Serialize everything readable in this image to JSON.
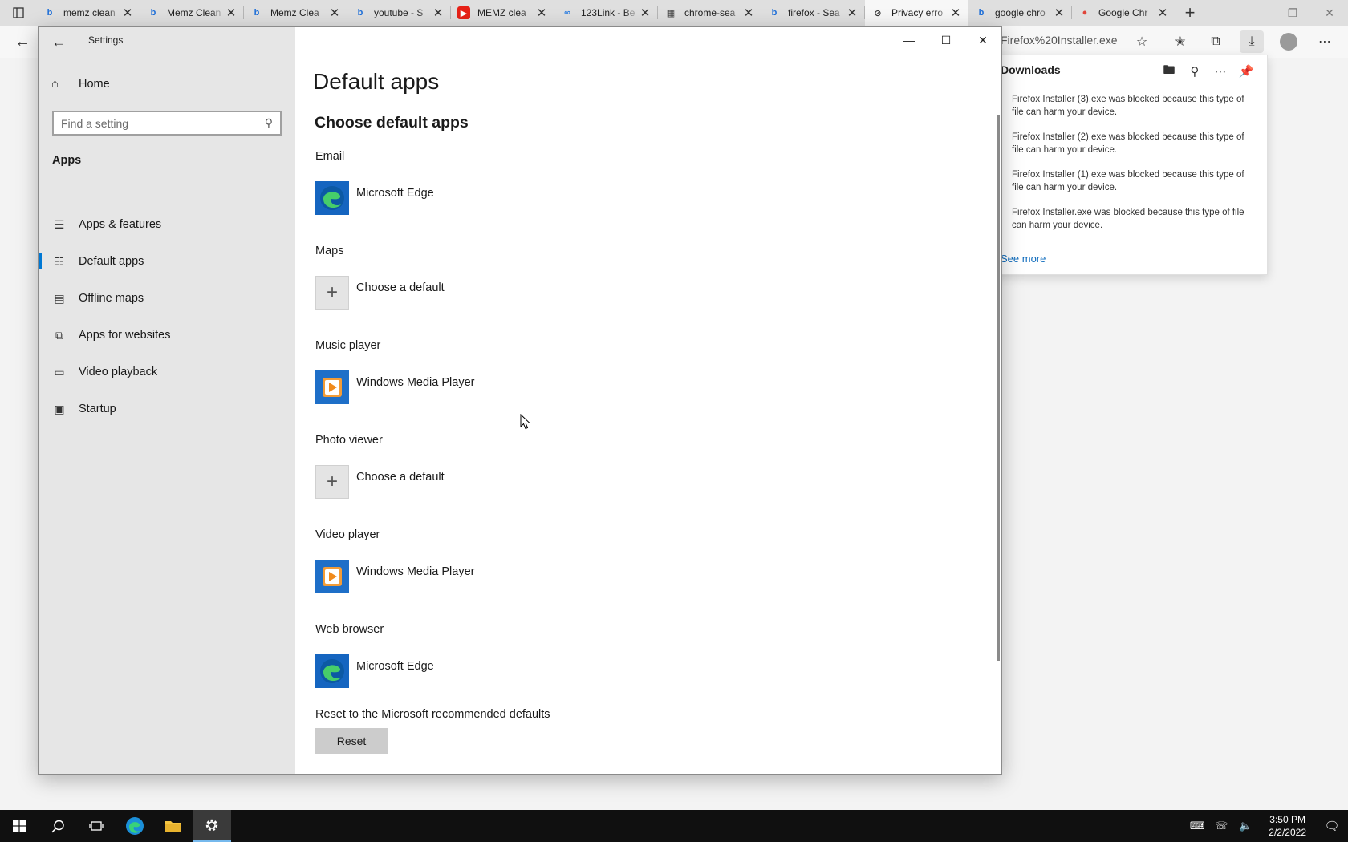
{
  "browser": {
    "tabs": [
      {
        "title": "memz clean",
        "icon": "bing-icon",
        "active": false
      },
      {
        "title": "Memz Clean",
        "icon": "bing-icon",
        "active": false
      },
      {
        "title": "Memz Clea",
        "icon": "bing-icon",
        "active": false
      },
      {
        "title": "youtube - S",
        "icon": "bing-icon",
        "active": false
      },
      {
        "title": "MEMZ clea",
        "icon": "youtube-icon",
        "active": false
      },
      {
        "title": "123Link - Be",
        "icon": "link-icon",
        "active": false
      },
      {
        "title": "chrome-sea",
        "icon": "page-icon",
        "active": false
      },
      {
        "title": "firefox - Sea",
        "icon": "bing-icon",
        "active": false
      },
      {
        "title": "Privacy erro",
        "icon": "warning-page-icon",
        "active": true
      },
      {
        "title": "google chro",
        "icon": "bing-icon",
        "active": false
      },
      {
        "title": "Google Chr",
        "icon": "chrome-icon",
        "active": false
      }
    ],
    "address_url": "Firefox%20Installer.exe",
    "accent": "#0f6cbd"
  },
  "downloads": {
    "title": "Downloads",
    "items": [
      {
        "text": "Firefox Installer (3).exe was blocked because this type of file can harm your device."
      },
      {
        "text": "Firefox Installer (2).exe was blocked because this type of file can harm your device."
      },
      {
        "text": "Firefox Installer (1).exe was blocked because this type of file can harm your device."
      },
      {
        "text": "Firefox Installer.exe was blocked because this type of file can harm your device."
      }
    ],
    "see_more": "See more"
  },
  "settings": {
    "window_title": "Settings",
    "home_label": "Home",
    "search_placeholder": "Find a setting",
    "section_title": "Apps",
    "nav": [
      {
        "label": "Apps & features",
        "icon": "list-icon",
        "selected": false
      },
      {
        "label": "Default apps",
        "icon": "default-apps-icon",
        "selected": true
      },
      {
        "label": "Offline maps",
        "icon": "map-icon",
        "selected": false
      },
      {
        "label": "Apps for websites",
        "icon": "web-app-icon",
        "selected": false
      },
      {
        "label": "Video playback",
        "icon": "video-icon",
        "selected": false
      },
      {
        "label": "Startup",
        "icon": "startup-icon",
        "selected": false
      }
    ],
    "page_title": "Default apps",
    "page_subtitle": "Choose default apps",
    "defaults": [
      {
        "category": "Email",
        "app": "Microsoft Edge",
        "tile": "edge-icon"
      },
      {
        "category": "Maps",
        "app": "Choose a default",
        "tile": "plus-icon"
      },
      {
        "category": "Music player",
        "app": "Windows Media Player",
        "tile": "wmp-icon"
      },
      {
        "category": "Photo viewer",
        "app": "Choose a default",
        "tile": "plus-icon"
      },
      {
        "category": "Video player",
        "app": "Windows Media Player",
        "tile": "wmp-icon"
      },
      {
        "category": "Web browser",
        "app": "Microsoft Edge",
        "tile": "edge-icon"
      }
    ],
    "reset_label": "Reset to the Microsoft recommended defaults",
    "reset_button": "Reset",
    "accent": "#0078d4"
  },
  "taskbar": {
    "time": "3:50 PM",
    "date": "2/2/2022"
  }
}
